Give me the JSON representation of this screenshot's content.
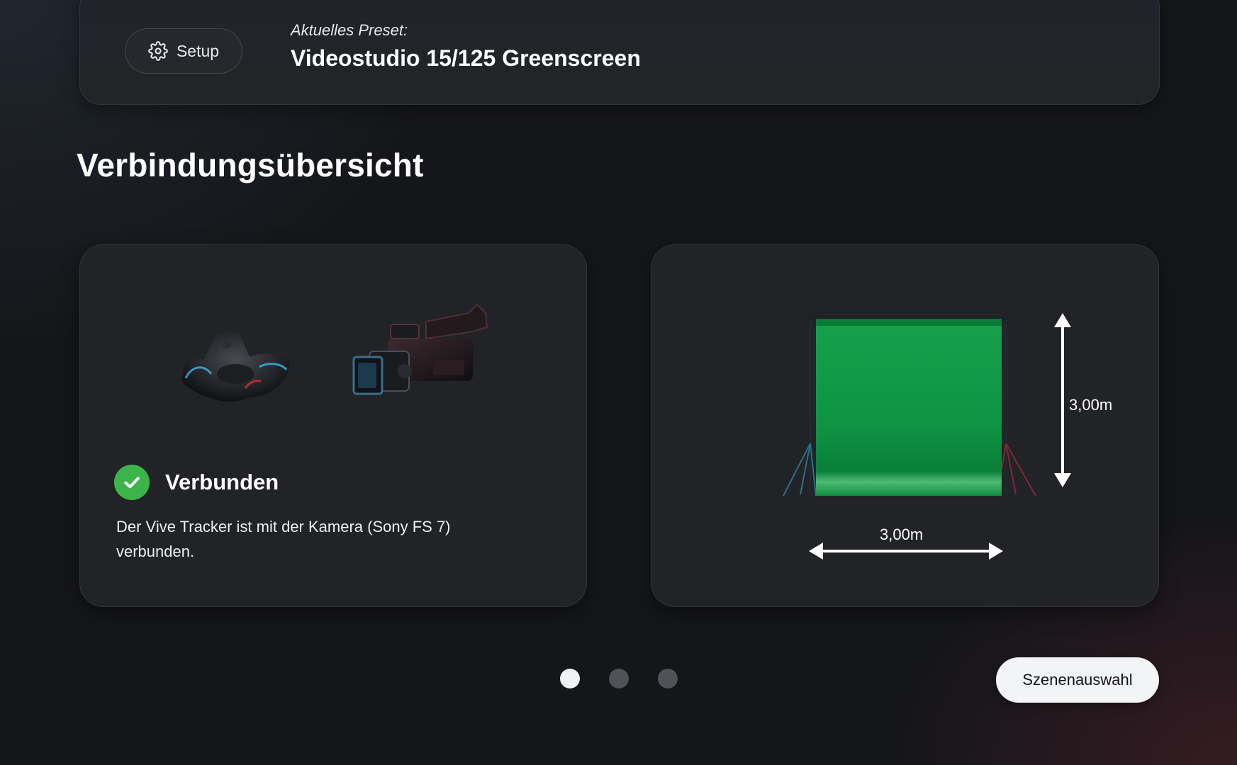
{
  "header": {
    "setup_label": "Setup",
    "preset_caption": "Aktuelles Preset:",
    "preset_name": "Videostudio 15/125 Greenscreen"
  },
  "overview": {
    "title": "Verbindungsübersicht"
  },
  "connection_card": {
    "status": "Verbunden",
    "description": "Der Vive Tracker ist mit der Kamera (Sony FS 7) verbunden.",
    "status_color": "#3bb54a"
  },
  "greenscreen_card": {
    "height_label": "3,00m",
    "width_label": "3,00m",
    "screen_color": "#11a04a"
  },
  "pagination": {
    "total": 3,
    "active_index": 0
  },
  "actions": {
    "scene_selection_label": "Szenenauswahl"
  },
  "icons": {
    "setup": "gear-icon",
    "status": "checkmark-circle-icon",
    "device_1": "vive-tracker-icon",
    "device_2": "video-camera-icon"
  }
}
